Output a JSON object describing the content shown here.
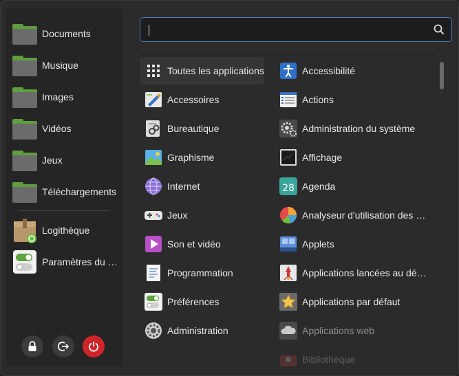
{
  "search": {
    "value": "",
    "placeholder": ""
  },
  "places": [
    {
      "label": "Documents",
      "icon": "folder-icon"
    },
    {
      "label": "Musique",
      "icon": "folder-icon"
    },
    {
      "label": "Images",
      "icon": "folder-icon"
    },
    {
      "label": "Vidéos",
      "icon": "folder-icon"
    },
    {
      "label": "Jeux",
      "icon": "folder-icon"
    },
    {
      "label": "Téléchargements",
      "icon": "folder-icon"
    }
  ],
  "favorites": [
    {
      "label": "Logithèque",
      "icon": "software-manager-icon"
    },
    {
      "label": "Paramètres du système",
      "icon": "settings-toggle-icon"
    }
  ],
  "system_buttons": [
    {
      "icon": "lock-icon"
    },
    {
      "icon": "logout-icon"
    },
    {
      "icon": "power-icon"
    }
  ],
  "categories": [
    {
      "label": "Toutes les applications",
      "icon": "grid-icon"
    },
    {
      "label": "Accessoires",
      "icon": "accessories-icon"
    },
    {
      "label": "Bureautique",
      "icon": "office-icon"
    },
    {
      "label": "Graphisme",
      "icon": "graphics-icon"
    },
    {
      "label": "Internet",
      "icon": "internet-icon"
    },
    {
      "label": "Jeux",
      "icon": "gamepad-icon"
    },
    {
      "label": "Son et vidéo",
      "icon": "media-icon"
    },
    {
      "label": "Programmation",
      "icon": "programming-icon"
    },
    {
      "label": "Préférences",
      "icon": "preferences-icon"
    },
    {
      "label": "Administration",
      "icon": "administration-icon"
    }
  ],
  "apps": [
    {
      "label": "Accessibilité",
      "icon": "accessibility-icon"
    },
    {
      "label": "Actions",
      "icon": "actions-icon"
    },
    {
      "label": "Administration du système",
      "icon": "gears-icon"
    },
    {
      "label": "Affichage",
      "icon": "display-icon"
    },
    {
      "label": "Agenda",
      "icon": "calendar-icon"
    },
    {
      "label": "Analyseur d'utilisation des disques",
      "icon": "pie-chart-icon"
    },
    {
      "label": "Applets",
      "icon": "applets-icon"
    },
    {
      "label": "Applications lancées au démarrage",
      "icon": "startup-icon"
    },
    {
      "label": "Applications par défaut",
      "icon": "star-icon"
    },
    {
      "label": "Applications web",
      "icon": "cloud-icon"
    },
    {
      "label": "Bibliothèque",
      "icon": "library-icon"
    }
  ],
  "colors": {
    "accent": "#4a7ebf",
    "folder_green": "#5f9e3f",
    "power_red": "#d0242b"
  }
}
